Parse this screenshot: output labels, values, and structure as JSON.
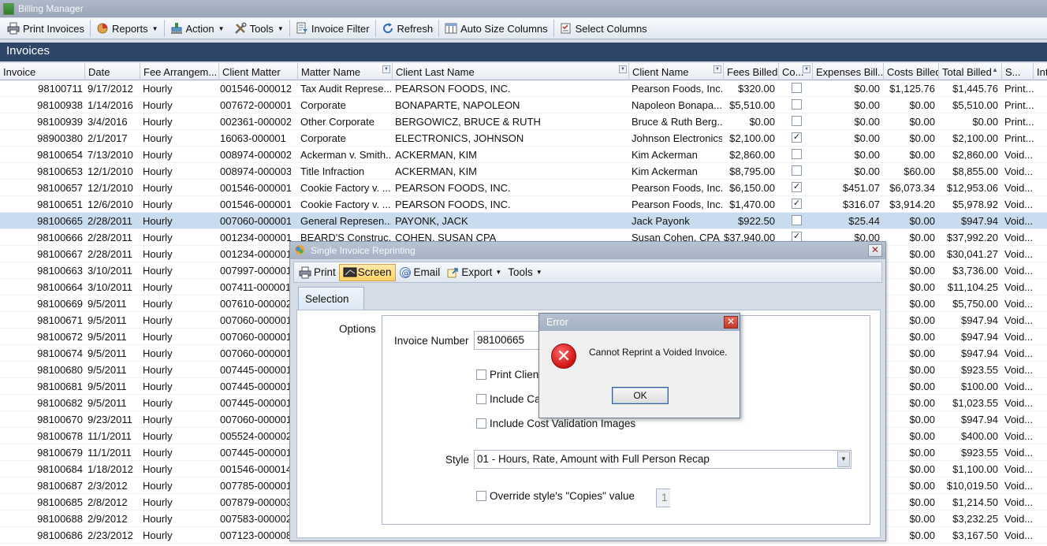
{
  "window": {
    "title": "Billing Manager"
  },
  "toolbar": {
    "print_invoices": "Print Invoices",
    "reports": "Reports",
    "action": "Action",
    "tools": "Tools",
    "invoice_filter": "Invoice Filter",
    "refresh": "Refresh",
    "auto_size_columns": "Auto Size Columns",
    "select_columns": "Select Columns"
  },
  "section": {
    "title": "Invoices"
  },
  "grid": {
    "headers": [
      "Invoice",
      "Date",
      "Fee Arrangem...",
      "Client Matter",
      "Matter Name",
      "Client Last Name",
      "Client Name",
      "Fees Billed",
      "Co...",
      "Expenses Bill...",
      "Costs Billed",
      "Total Billed",
      "S...",
      "Int"
    ],
    "rows": [
      {
        "invoice": "98100711",
        "date": "9/17/2012",
        "fee": "Hourly",
        "matter": "001546-000012",
        "matter_name": "Tax Audit Represe...",
        "last": "PEARSON FOODS, INC.",
        "client": "Pearson Foods, Inc.",
        "fees": "$320.00",
        "co": false,
        "exp": "$0.00",
        "costs": "$1,125.76",
        "total": "$1,445.76",
        "status": "Print..."
      },
      {
        "invoice": "98100938",
        "date": "1/14/2016",
        "fee": "Hourly",
        "matter": "007672-000001",
        "matter_name": "Corporate",
        "last": "BONAPARTE, NAPOLEON",
        "client": "Napoleon Bonapa...",
        "fees": "$5,510.00",
        "co": false,
        "exp": "$0.00",
        "costs": "$0.00",
        "total": "$5,510.00",
        "status": "Print..."
      },
      {
        "invoice": "98100939",
        "date": "3/4/2016",
        "fee": "Hourly",
        "matter": "002361-000002",
        "matter_name": "Other Corporate",
        "last": "BERGOWICZ, BRUCE & RUTH",
        "client": "Bruce & Ruth Berg...",
        "fees": "$0.00",
        "co": false,
        "exp": "$0.00",
        "costs": "$0.00",
        "total": "$0.00",
        "status": "Print..."
      },
      {
        "invoice": "98900380",
        "date": "2/1/2017",
        "fee": "Hourly",
        "matter": "16063-000001",
        "matter_name": "Corporate",
        "last": "ELECTRONICS, JOHNSON",
        "client": "Johnson Electronics",
        "fees": "$2,100.00",
        "co": true,
        "exp": "$0.00",
        "costs": "$0.00",
        "total": "$2,100.00",
        "status": "Print..."
      },
      {
        "invoice": "98100654",
        "date": "7/13/2010",
        "fee": "Hourly",
        "matter": "008974-000002",
        "matter_name": "Ackerman v. Smith...",
        "last": "ACKERMAN, KIM",
        "client": "Kim Ackerman",
        "fees": "$2,860.00",
        "co": false,
        "exp": "$0.00",
        "costs": "$0.00",
        "total": "$2,860.00",
        "status": "Void..."
      },
      {
        "invoice": "98100653",
        "date": "12/1/2010",
        "fee": "Hourly",
        "matter": "008974-000003",
        "matter_name": "Title Infraction",
        "last": "ACKERMAN, KIM",
        "client": "Kim Ackerman",
        "fees": "$8,795.00",
        "co": false,
        "exp": "$0.00",
        "costs": "$60.00",
        "total": "$8,855.00",
        "status": "Void..."
      },
      {
        "invoice": "98100657",
        "date": "12/1/2010",
        "fee": "Hourly",
        "matter": "001546-000001",
        "matter_name": "Cookie Factory v. ...",
        "last": "PEARSON FOODS, INC.",
        "client": "Pearson Foods, Inc.",
        "fees": "$6,150.00",
        "co": true,
        "exp": "$451.07",
        "costs": "$6,073.34",
        "total": "$12,953.06",
        "status": "Void..."
      },
      {
        "invoice": "98100651",
        "date": "12/6/2010",
        "fee": "Hourly",
        "matter": "001546-000001",
        "matter_name": "Cookie Factory v. ...",
        "last": "PEARSON FOODS, INC.",
        "client": "Pearson Foods, Inc.",
        "fees": "$1,470.00",
        "co": true,
        "exp": "$316.07",
        "costs": "$3,914.20",
        "total": "$5,978.92",
        "status": "Void..."
      },
      {
        "invoice": "98100665",
        "date": "2/28/2011",
        "fee": "Hourly",
        "matter": "007060-000001",
        "matter_name": "General Represen...",
        "last": "PAYONK, JACK",
        "client": "Jack Payonk",
        "fees": "$922.50",
        "co": false,
        "exp": "$25.44",
        "costs": "$0.00",
        "total": "$947.94",
        "status": "Void...",
        "selected": true
      },
      {
        "invoice": "98100666",
        "date": "2/28/2011",
        "fee": "Hourly",
        "matter": "001234-000001",
        "matter_name": "BEARD'S Construc...",
        "last": "COHEN, SUSAN CPA",
        "client": "Susan Cohen, CPA",
        "fees": "$37,940.00",
        "co": true,
        "exp": "$0.00",
        "costs": "$0.00",
        "total": "$37,992.20",
        "status": "Void..."
      },
      {
        "invoice": "98100667",
        "date": "2/28/2011",
        "fee": "Hourly",
        "matter": "001234-000001",
        "costs": "$0.00",
        "total": "$30,041.27",
        "status": "Void..."
      },
      {
        "invoice": "98100663",
        "date": "3/10/2011",
        "fee": "Hourly",
        "matter": "007997-000001",
        "costs": "$0.00",
        "total": "$3,736.00",
        "status": "Void..."
      },
      {
        "invoice": "98100664",
        "date": "3/10/2011",
        "fee": "Hourly",
        "matter": "007411-000001",
        "costs": "$0.00",
        "total": "$11,104.25",
        "status": "Void..."
      },
      {
        "invoice": "98100669",
        "date": "9/5/2011",
        "fee": "Hourly",
        "matter": "007610-000002",
        "costs": "$0.00",
        "total": "$5,750.00",
        "status": "Void..."
      },
      {
        "invoice": "98100671",
        "date": "9/5/2011",
        "fee": "Hourly",
        "matter": "007060-000001",
        "costs": "$0.00",
        "total": "$947.94",
        "status": "Void..."
      },
      {
        "invoice": "98100672",
        "date": "9/5/2011",
        "fee": "Hourly",
        "matter": "007060-000001",
        "costs": "$0.00",
        "total": "$947.94",
        "status": "Void..."
      },
      {
        "invoice": "98100674",
        "date": "9/5/2011",
        "fee": "Hourly",
        "matter": "007060-000001",
        "costs": "$0.00",
        "total": "$947.94",
        "status": "Void..."
      },
      {
        "invoice": "98100680",
        "date": "9/5/2011",
        "fee": "Hourly",
        "matter": "007445-000001",
        "costs": "$0.00",
        "total": "$923.55",
        "status": "Void..."
      },
      {
        "invoice": "98100681",
        "date": "9/5/2011",
        "fee": "Hourly",
        "matter": "007445-000001",
        "costs": "$0.00",
        "total": "$100.00",
        "status": "Void..."
      },
      {
        "invoice": "98100682",
        "date": "9/5/2011",
        "fee": "Hourly",
        "matter": "007445-000001",
        "costs": "$0.00",
        "total": "$1,023.55",
        "status": "Void..."
      },
      {
        "invoice": "98100670",
        "date": "9/23/2011",
        "fee": "Hourly",
        "matter": "007060-000001",
        "costs": "$0.00",
        "total": "$947.94",
        "status": "Void..."
      },
      {
        "invoice": "98100678",
        "date": "11/1/2011",
        "fee": "Hourly",
        "matter": "005524-000002",
        "costs": "$0.00",
        "total": "$400.00",
        "status": "Void..."
      },
      {
        "invoice": "98100679",
        "date": "11/1/2011",
        "fee": "Hourly",
        "matter": "007445-000001",
        "costs": "$0.00",
        "total": "$923.55",
        "status": "Void..."
      },
      {
        "invoice": "98100684",
        "date": "1/18/2012",
        "fee": "Hourly",
        "matter": "001546-000014",
        "costs": "$0.00",
        "total": "$1,100.00",
        "status": "Void..."
      },
      {
        "invoice": "98100687",
        "date": "2/3/2012",
        "fee": "Hourly",
        "matter": "007785-000001",
        "costs": "$0.00",
        "total": "$10,019.50",
        "status": "Void..."
      },
      {
        "invoice": "98100685",
        "date": "2/8/2012",
        "fee": "Hourly",
        "matter": "007879-000003",
        "costs": "$0.00",
        "total": "$1,214.50",
        "status": "Void..."
      },
      {
        "invoice": "98100688",
        "date": "2/9/2012",
        "fee": "Hourly",
        "matter": "007583-000002",
        "costs": "$0.00",
        "total": "$3,232.25",
        "status": "Void..."
      },
      {
        "invoice": "98100686",
        "date": "2/23/2012",
        "fee": "Hourly",
        "matter": "007123-000008",
        "costs": "$0.00",
        "total": "$3,167.50",
        "status": "Void..."
      }
    ]
  },
  "reprint_dialog": {
    "title": "Single Invoice Reprinting",
    "toolbar": {
      "print": "Print",
      "screen": "Screen",
      "email": "Email",
      "export": "Export",
      "tools": "Tools"
    },
    "tab": "Selection",
    "options_label": "Options",
    "invoice_number_label": "Invoice Number",
    "invoice_number_value": "98100665",
    "print_client": "Print Client",
    "include_ca": "Include Ca",
    "include_cost_validation": "Include Cost Validation Images",
    "style_label": "Style",
    "style_value": "01 - Hours, Rate, Amount with Full Person Recap",
    "override_copies": "Override style's \"Copies\" value",
    "copies_value": "1"
  },
  "error_dialog": {
    "title": "Error",
    "message": "Cannot Reprint a Voided Invoice.",
    "ok_label": "OK"
  }
}
